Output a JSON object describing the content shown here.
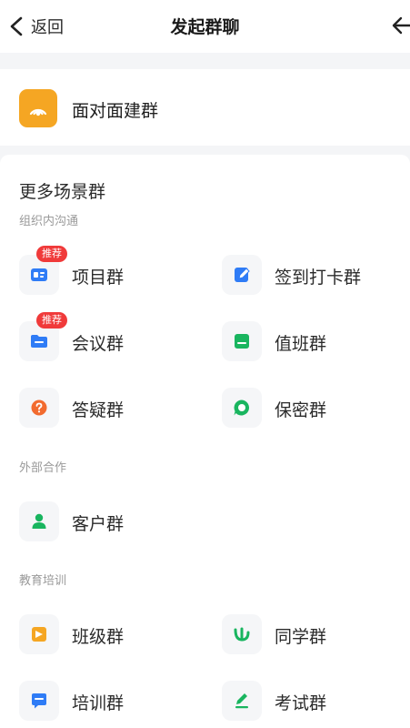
{
  "navbar": {
    "back_label": "返回",
    "title": "发起群聊",
    "right_icon": "share-arrow-icon"
  },
  "face_group": {
    "label": "面对面建群",
    "icon": "signal-waves-icon",
    "icon_color": "#f5a623"
  },
  "more_scenes": {
    "title": "更多场景群",
    "categories": [
      {
        "label": "组织内沟通",
        "items": [
          {
            "label": "项目群",
            "badge": "推荐",
            "icon": "project-card-icon",
            "color": "#2f7cf6"
          },
          {
            "label": "签到打卡群",
            "badge": "",
            "icon": "checkin-pen-icon",
            "color": "#2f7cf6"
          },
          {
            "label": "会议群",
            "badge": "推荐",
            "icon": "meeting-folder-icon",
            "color": "#2f7cf6"
          },
          {
            "label": "值班群",
            "badge": "",
            "icon": "duty-schedule-icon",
            "color": "#19b55f"
          },
          {
            "label": "答疑群",
            "badge": "",
            "icon": "question-icon",
            "color": "#f26b2f"
          },
          {
            "label": "保密群",
            "badge": "",
            "icon": "confidential-chat-icon",
            "color": "#19b55f"
          }
        ]
      },
      {
        "label": "外部合作",
        "items": [
          {
            "label": "客户群",
            "badge": "",
            "icon": "customer-person-icon",
            "color": "#19b55f"
          }
        ]
      },
      {
        "label": "教育培训",
        "items": [
          {
            "label": "班级群",
            "badge": "",
            "icon": "class-board-icon",
            "color": "#f5a623"
          },
          {
            "label": "同学群",
            "badge": "",
            "icon": "classmate-hands-icon",
            "color": "#19b55f"
          },
          {
            "label": "培训群",
            "badge": "",
            "icon": "training-chat-icon",
            "color": "#2f7cf6"
          },
          {
            "label": "考试群",
            "badge": "",
            "icon": "exam-pencil-icon",
            "color": "#19b55f"
          }
        ]
      }
    ]
  }
}
